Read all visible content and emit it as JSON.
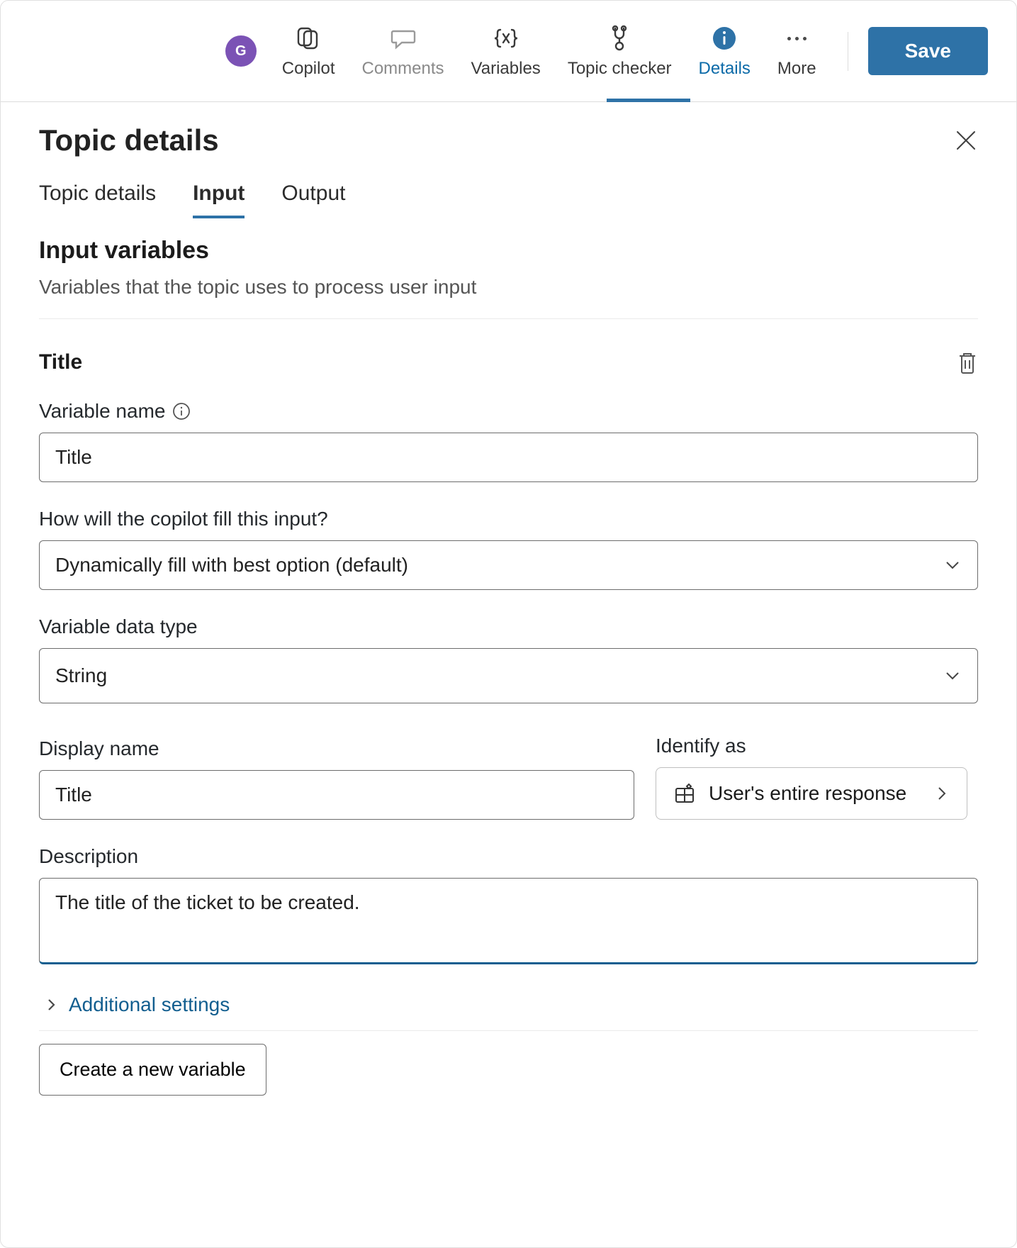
{
  "toolbar": {
    "avatar_letter": "G",
    "items": [
      {
        "label": "Copilot"
      },
      {
        "label": "Comments"
      },
      {
        "label": "Variables"
      },
      {
        "label": "Topic checker"
      },
      {
        "label": "Details"
      },
      {
        "label": "More"
      }
    ],
    "save_label": "Save"
  },
  "panel": {
    "title": "Topic details",
    "tabs": [
      {
        "label": "Topic details"
      },
      {
        "label": "Input"
      },
      {
        "label": "Output"
      }
    ],
    "section_heading": "Input variables",
    "section_sub": "Variables that the topic uses to process user input",
    "variable_title": "Title",
    "fields": {
      "variable_name_label": "Variable name",
      "variable_name_value": "Title",
      "fill_label": "How will the copilot fill this input?",
      "fill_value": "Dynamically fill with best option (default)",
      "data_type_label": "Variable data type",
      "data_type_value": "String",
      "display_name_label": "Display name",
      "display_name_value": "Title",
      "identify_label": "Identify as",
      "identify_value": "User's entire response",
      "description_label": "Description",
      "description_value": "The title of the ticket to be created."
    },
    "additional_settings_label": "Additional settings",
    "create_variable_label": "Create a new variable"
  }
}
